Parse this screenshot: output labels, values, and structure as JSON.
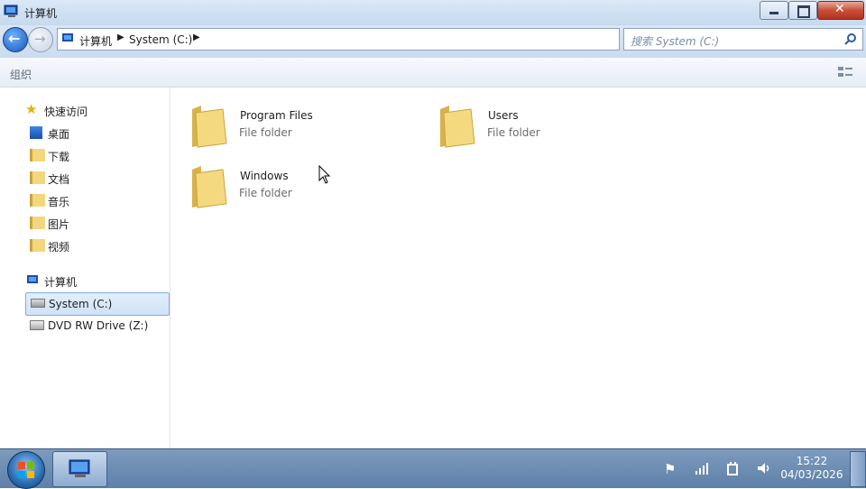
{
  "window": {
    "title": "计算机"
  },
  "address_bar": {
    "crumbs": [
      "计算机",
      "System (C:)"
    ]
  },
  "search": {
    "placeholder": "搜索 System (C:)"
  },
  "toolbar": {
    "organize_label": "组织"
  },
  "nav": {
    "quick_access_label": "快速访问",
    "quick_items": [
      "桌面",
      "下载",
      "文档",
      "音乐",
      "图片",
      "视频"
    ],
    "computer_label": "计算机",
    "drives": [
      {
        "label": "System (C:)",
        "selected": true
      },
      {
        "label": "DVD RW Drive (Z:)",
        "selected": false
      }
    ]
  },
  "content": {
    "items": [
      {
        "name": "Program Files",
        "type": "File folder"
      },
      {
        "name": "Users",
        "type": "File folder"
      },
      {
        "name": "Windows",
        "type": "File folder"
      }
    ]
  },
  "taskbar": {
    "time": "15:22",
    "date": "04/03/2026"
  },
  "colors": {
    "accent": "#3a7bd5",
    "folder": "#f2d77e",
    "selection": "#cfe2f8"
  }
}
